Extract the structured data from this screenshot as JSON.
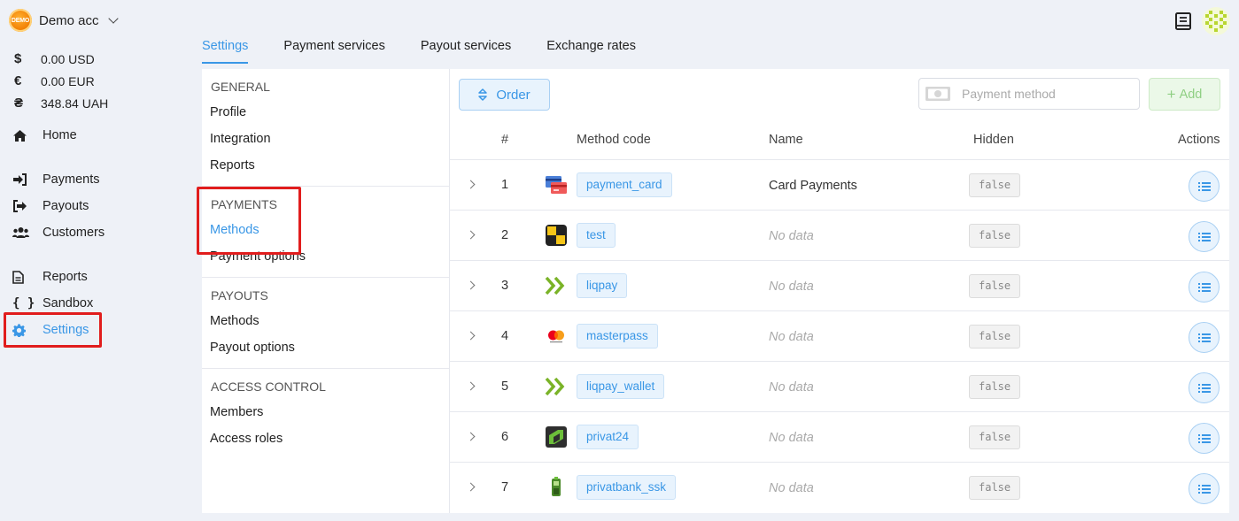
{
  "account": {
    "logo_text": "DEMO",
    "name": "Demo acc"
  },
  "balances": [
    {
      "symbol": "$",
      "amount": "0.00 USD"
    },
    {
      "symbol": "€",
      "amount": "0.00 EUR"
    },
    {
      "symbol": "₴",
      "amount": "348.84 UAH"
    }
  ],
  "nav": {
    "home": "Home",
    "payments": "Payments",
    "payouts": "Payouts",
    "customers": "Customers",
    "reports": "Reports",
    "sandbox": "Sandbox",
    "settings": "Settings"
  },
  "tabs": [
    "Settings",
    "Payment services",
    "Payout services",
    "Exchange rates"
  ],
  "menu": {
    "general": {
      "head": "GENERAL",
      "items": [
        "Profile",
        "Integration",
        "Reports"
      ]
    },
    "payments": {
      "head": "PAYMENTS",
      "items": [
        "Methods",
        "Payment options"
      ]
    },
    "payouts": {
      "head": "PAYOUTS",
      "items": [
        "Methods",
        "Payout options"
      ]
    },
    "access": {
      "head": "ACCESS CONTROL",
      "items": [
        "Members",
        "Access roles"
      ]
    }
  },
  "toolbar": {
    "order_label": "Order",
    "search_placeholder": "Payment method",
    "add_label": "Add"
  },
  "table": {
    "headers": {
      "num": "#",
      "code": "Method code",
      "name": "Name",
      "hidden": "Hidden",
      "actions": "Actions"
    },
    "rows": [
      {
        "num": "1",
        "code": "payment_card",
        "name": "Card Payments",
        "hidden": "false",
        "logo": "card-icon"
      },
      {
        "num": "2",
        "code": "test",
        "name": "No data",
        "hidden": "false",
        "logo": "test-icon"
      },
      {
        "num": "3",
        "code": "liqpay",
        "name": "No data",
        "hidden": "false",
        "logo": "liqpay-icon"
      },
      {
        "num": "4",
        "code": "masterpass",
        "name": "No data",
        "hidden": "false",
        "logo": "mastercard-icon"
      },
      {
        "num": "5",
        "code": "liqpay_wallet",
        "name": "No data",
        "hidden": "false",
        "logo": "liqpay-icon"
      },
      {
        "num": "6",
        "code": "privat24",
        "name": "No data",
        "hidden": "false",
        "logo": "privat24-icon"
      },
      {
        "num": "7",
        "code": "privatbank_ssk",
        "name": "No data",
        "hidden": "false",
        "logo": "terminal-icon"
      }
    ]
  },
  "colors": {
    "accent": "#3a97e6",
    "highlight": "#e11d1d",
    "add_green": "#8fcf83"
  }
}
